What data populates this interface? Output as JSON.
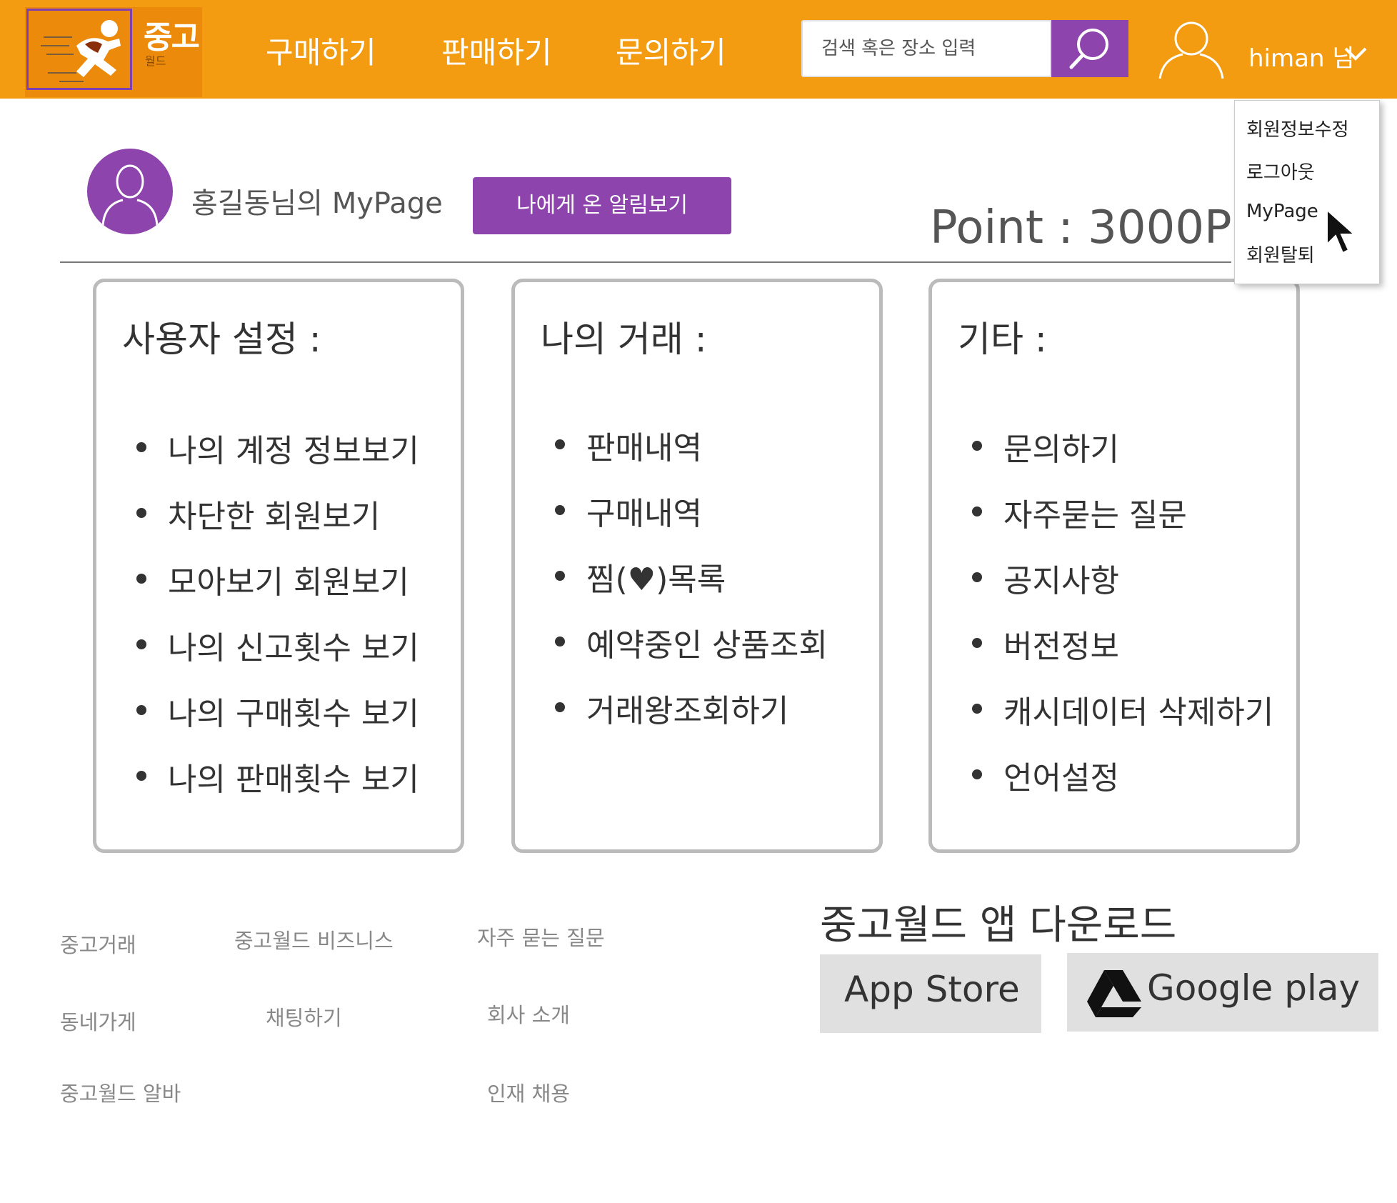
{
  "header": {
    "logo_text": "중고",
    "logo_sub": "월드",
    "nav": [
      "구매하기",
      "판매하기",
      "문의하기"
    ],
    "search_placeholder": "검색 혹은 장소 입력",
    "username": "himan 님"
  },
  "dropdown": {
    "items": [
      "회원정보수정",
      "로그아웃",
      "MyPage",
      "회원탈퇴"
    ]
  },
  "profile": {
    "title": "홍길동님의 MyPage",
    "notify_button": "나에게 온 알림보기",
    "point": "Point :  3000P"
  },
  "panels": {
    "user_settings": {
      "title": "사용자 설정 :",
      "items": [
        "나의 계정 정보보기",
        "차단한 회원보기",
        "모아보기 회원보기",
        "나의 신고횟수 보기",
        "나의 구매횟수 보기",
        "나의 판매횟수 보기"
      ]
    },
    "my_trades": {
      "title": "나의 거래 :",
      "items": [
        "판매내역",
        "구매내역",
        "찜(♥)목록",
        "예약중인 상품조회",
        "거래왕조회하기"
      ]
    },
    "etc": {
      "title": "기타 :",
      "items": [
        "문의하기",
        "자주묻는 질문",
        "공지사항",
        "버전정보",
        "캐시데이터 삭제하기",
        "언어설정"
      ]
    }
  },
  "footer": {
    "links": {
      "col1": [
        "중고거래",
        "동네가게",
        "중고월드 알바"
      ],
      "col2": [
        "중고월드 비즈니스",
        "채팅하기"
      ],
      "col3": [
        "자주 묻는 질문",
        "회사 소개",
        "인재 채용"
      ]
    },
    "app_download_title": "중고월드 앱 다운로드",
    "app_store": "App Store",
    "google_play": "Google play"
  },
  "colors": {
    "header_bg": "#f39c12",
    "accent_purple": "#8e44ad",
    "panel_border": "#bbbbbb"
  }
}
